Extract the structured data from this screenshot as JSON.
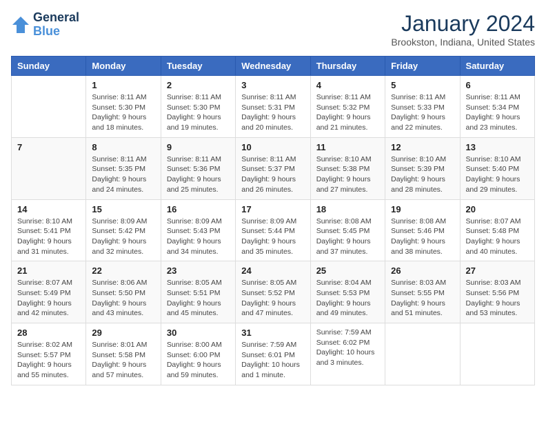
{
  "logo": {
    "line1": "General",
    "line2": "Blue"
  },
  "title": "January 2024",
  "subtitle": "Brookston, Indiana, United States",
  "weekdays": [
    "Sunday",
    "Monday",
    "Tuesday",
    "Wednesday",
    "Thursday",
    "Friday",
    "Saturday"
  ],
  "weeks": [
    [
      {
        "day": "",
        "info": ""
      },
      {
        "day": "1",
        "info": "Sunrise: 8:11 AM\nSunset: 5:30 PM\nDaylight: 9 hours\nand 18 minutes."
      },
      {
        "day": "2",
        "info": "Sunrise: 8:11 AM\nSunset: 5:30 PM\nDaylight: 9 hours\nand 19 minutes."
      },
      {
        "day": "3",
        "info": "Sunrise: 8:11 AM\nSunset: 5:31 PM\nDaylight: 9 hours\nand 20 minutes."
      },
      {
        "day": "4",
        "info": "Sunrise: 8:11 AM\nSunset: 5:32 PM\nDaylight: 9 hours\nand 21 minutes."
      },
      {
        "day": "5",
        "info": "Sunrise: 8:11 AM\nSunset: 5:33 PM\nDaylight: 9 hours\nand 22 minutes."
      },
      {
        "day": "6",
        "info": "Sunrise: 8:11 AM\nSunset: 5:34 PM\nDaylight: 9 hours\nand 23 minutes."
      }
    ],
    [
      {
        "day": "7",
        "info": ""
      },
      {
        "day": "8",
        "info": "Sunrise: 8:11 AM\nSunset: 5:35 PM\nDaylight: 9 hours\nand 24 minutes."
      },
      {
        "day": "9",
        "info": "Sunrise: 8:11 AM\nSunset: 5:36 PM\nDaylight: 9 hours\nand 25 minutes."
      },
      {
        "day": "10",
        "info": "Sunrise: 8:11 AM\nSunset: 5:37 PM\nDaylight: 9 hours\nand 26 minutes."
      },
      {
        "day": "11",
        "info": "Sunrise: 8:10 AM\nSunset: 5:38 PM\nDaylight: 9 hours\nand 27 minutes."
      },
      {
        "day": "12",
        "info": "Sunrise: 8:10 AM\nSunset: 5:39 PM\nDaylight: 9 hours\nand 28 minutes."
      },
      {
        "day": "13",
        "info": "Sunrise: 8:10 AM\nSunset: 5:40 PM\nDaylight: 9 hours\nand 29 minutes."
      }
    ],
    [
      {
        "day": "14",
        "info": "Sunrise: 8:10 AM\nSunset: 5:41 PM\nDaylight: 9 hours\nand 31 minutes."
      },
      {
        "day": "15",
        "info": "Sunrise: 8:09 AM\nSunset: 5:42 PM\nDaylight: 9 hours\nand 32 minutes."
      },
      {
        "day": "16",
        "info": "Sunrise: 8:09 AM\nSunset: 5:43 PM\nDaylight: 9 hours\nand 34 minutes."
      },
      {
        "day": "17",
        "info": "Sunrise: 8:09 AM\nSunset: 5:44 PM\nDaylight: 9 hours\nand 35 minutes."
      },
      {
        "day": "18",
        "info": "Sunrise: 8:08 AM\nSunset: 5:45 PM\nDaylight: 9 hours\nand 37 minutes."
      },
      {
        "day": "19",
        "info": "Sunrise: 8:08 AM\nSunset: 5:46 PM\nDaylight: 9 hours\nand 38 minutes."
      },
      {
        "day": "20",
        "info": "Sunrise: 8:07 AM\nSunset: 5:48 PM\nDaylight: 9 hours\nand 40 minutes."
      }
    ],
    [
      {
        "day": "21",
        "info": "Sunrise: 8:07 AM\nSunset: 5:49 PM\nDaylight: 9 hours\nand 42 minutes."
      },
      {
        "day": "22",
        "info": "Sunrise: 8:06 AM\nSunset: 5:50 PM\nDaylight: 9 hours\nand 43 minutes."
      },
      {
        "day": "23",
        "info": "Sunrise: 8:05 AM\nSunset: 5:51 PM\nDaylight: 9 hours\nand 45 minutes."
      },
      {
        "day": "24",
        "info": "Sunrise: 8:05 AM\nSunset: 5:52 PM\nDaylight: 9 hours\nand 47 minutes."
      },
      {
        "day": "25",
        "info": "Sunrise: 8:04 AM\nSunset: 5:53 PM\nDaylight: 9 hours\nand 49 minutes."
      },
      {
        "day": "26",
        "info": "Sunrise: 8:03 AM\nSunset: 5:55 PM\nDaylight: 9 hours\nand 51 minutes."
      },
      {
        "day": "27",
        "info": "Sunrise: 8:03 AM\nSunset: 5:56 PM\nDaylight: 9 hours\nand 53 minutes."
      }
    ],
    [
      {
        "day": "28",
        "info": "Sunrise: 8:02 AM\nSunset: 5:57 PM\nDaylight: 9 hours\nand 55 minutes."
      },
      {
        "day": "29",
        "info": "Sunrise: 8:01 AM\nSunset: 5:58 PM\nDaylight: 9 hours\nand 57 minutes."
      },
      {
        "day": "30",
        "info": "Sunrise: 8:00 AM\nSunset: 6:00 PM\nDaylight: 9 hours\nand 59 minutes."
      },
      {
        "day": "31",
        "info": "Sunrise: 7:59 AM\nSunset: 6:01 PM\nDaylight: 10 hours\nand 1 minute."
      },
      {
        "day": "",
        "info": "Sunrise: 7:59 AM\nSunset: 6:02 PM\nDaylight: 10 hours\nand 3 minutes."
      },
      {
        "day": "",
        "info": ""
      },
      {
        "day": "",
        "info": ""
      }
    ]
  ]
}
